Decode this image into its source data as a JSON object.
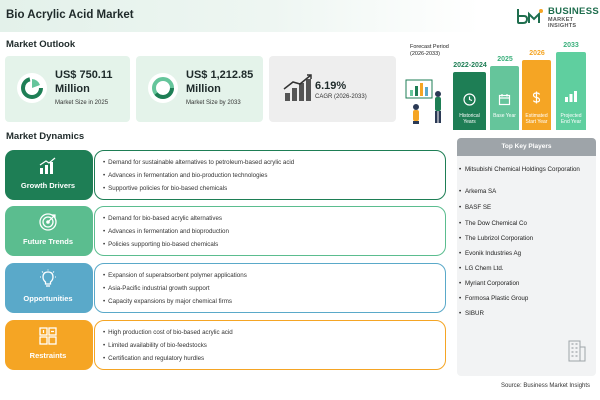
{
  "header": {
    "title": "Bio Acrylic Acid Market",
    "logo_name": "BUSINESS",
    "logo_sub": "MARKET INSIGHTS"
  },
  "outlook": {
    "title": "Market Outlook",
    "cards": [
      {
        "value": "US$ 750.11 Million",
        "label": "Market Size in 2025",
        "color": "#e4f3ea",
        "icon": "pie-chart-icon"
      },
      {
        "value": "US$ 1,212.85 Million",
        "label": "Market Size by 2033",
        "color": "#e4f3ea",
        "icon": "donut-chart-icon"
      },
      {
        "value": "6.19%",
        "label": "CAGR (2026-2033)",
        "color": "#eeeeee",
        "icon": "bar-chart-trend-icon"
      }
    ],
    "forecast_label": "Forecast Period\n(2026-2033)",
    "timeline": [
      {
        "year": "2022-2024",
        "caption": "Historical Years",
        "color": "#1e7e55",
        "icon": "clock-icon"
      },
      {
        "year": "2025",
        "caption": "Base Year",
        "color": "#65c59b",
        "icon": "calendar-icon"
      },
      {
        "year": "2026",
        "caption": "Estimated Start Year",
        "color": "#f5a524",
        "icon": "dollar-icon"
      },
      {
        "year": "2033",
        "caption": "Projected End Year",
        "color": "#5fcf9f",
        "icon": "bar-chart-icon"
      }
    ]
  },
  "dynamics": {
    "title": "Market Dynamics",
    "rows": [
      {
        "label": "Growth Drivers",
        "color": "#1e7e55",
        "icon": "rising-bars-icon",
        "items": [
          "Demand for sustainable alternatives to petroleum-based acrylic acid",
          "Advances in fermentation and bio-production technologies",
          "Supportive policies for bio-based chemicals"
        ]
      },
      {
        "label": "Future Trends",
        "color": "#5bbd8f",
        "icon": "target-icon",
        "items": [
          "Demand for bio-based acrylic alternatives",
          "Advances in fermentation and bioproduction",
          "Policies supporting bio-based chemicals"
        ]
      },
      {
        "label": "Opportunities",
        "color": "#5aa9c9",
        "icon": "lightbulb-icon",
        "items": [
          "Expansion of superabsorbent polymer applications",
          "Asia-Pacific industrial growth support",
          "Capacity expansions by major chemical firms"
        ]
      },
      {
        "label": "Restraints",
        "color": "#f5a524",
        "icon": "blocks-icon",
        "items": [
          "High production cost of bio-based acrylic acid",
          "Limited availability of bio-feedstocks",
          "Certification and regulatory hurdles"
        ]
      }
    ]
  },
  "players": {
    "title": "Top Key Players",
    "items": [
      "Mitsubishi Chemical Holdings Corporation",
      "Arkema SA",
      "BASF SE",
      "The Dow Chemical Co",
      "The Lubrizol Corporation",
      "Evonik Industries Ag",
      "LG Chem Ltd.",
      "Myriant Corporation",
      "Formosa Plastic Group",
      "SIBUR"
    ]
  },
  "source": "Source: Business Market Insights"
}
